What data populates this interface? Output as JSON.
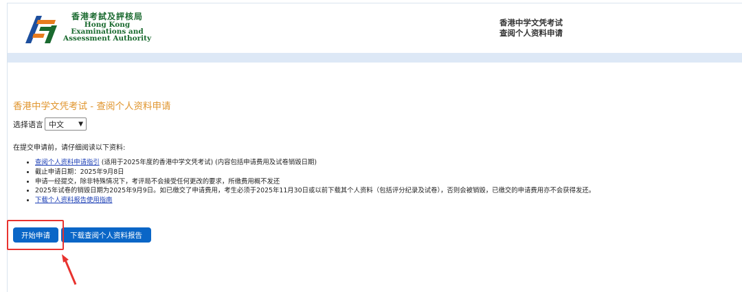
{
  "header": {
    "logo": {
      "zh": "香港考試及評核局",
      "en_line1": "Hong Kong",
      "en_line2": "Examinations and",
      "en_line3": "Assessment Authority"
    },
    "right_line1": "香港中学文凭考试",
    "right_line2": "查阅个人资料申请"
  },
  "page": {
    "title": "香港中学文凭考试 - 查阅个人资料申请",
    "language_label": "选择语言",
    "language_selected": "中文",
    "intro": "在提交申请前，请仔细阅读以下资料:",
    "items": [
      {
        "link": "查阅个人资料申请指引",
        "text": " (适用于2025年度的香港中学文凭考试) (内容包括申请费用及试卷销毁日期)"
      },
      {
        "text": "截止申请日期：2025年9月8日"
      },
      {
        "text": "申请一经提交，除非特殊情况下，考评局不会接受任何更改的要求，所缴费用概不发还"
      },
      {
        "text": "2025年试卷的销毁日期为2025年9月9日。如已缴交了申请费用，考生必须于2025年11月30日或以前下载其个人资料（包括评分纪录及试卷），否则会被销毁，已缴交的申请费用亦不会获得发还。"
      },
      {
        "link": "下载个人资料报告使用指南"
      }
    ],
    "buttons": {
      "start": "开始申请",
      "download": "下载查阅个人资料报告"
    }
  },
  "colors": {
    "title": "#e0952e",
    "button": "#0a66c7",
    "highlight": "#e8322e",
    "band": "#dde8f6",
    "logo_green": "#1a6a2f"
  }
}
